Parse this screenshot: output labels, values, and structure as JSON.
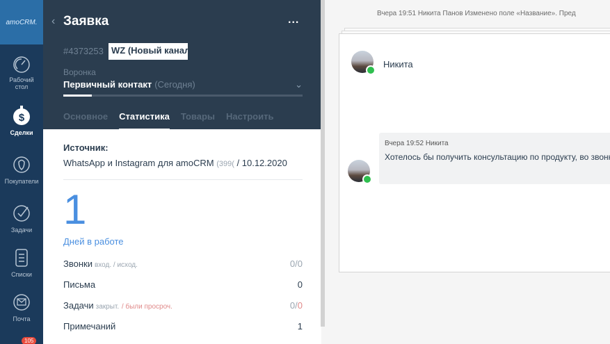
{
  "nav": {
    "logo": "amoCRM.",
    "items": [
      {
        "label": "Рабочий стол",
        "icon": "dashboard-icon"
      },
      {
        "label": "Сделки",
        "icon": "deals-icon"
      },
      {
        "label": "Покупатели",
        "icon": "customers-icon"
      },
      {
        "label": "Задачи",
        "icon": "tasks-icon"
      },
      {
        "label": "Списки",
        "icon": "lists-icon"
      },
      {
        "label": "Почта",
        "icon": "mail-icon"
      }
    ],
    "badge": "105"
  },
  "card": {
    "title": "Заявка",
    "more": "...",
    "lead_id": "#4373253",
    "lead_name": "WZ (Новый канал",
    "funnel_label": "Воронка",
    "stage_name": "Первичный контакт",
    "stage_time": "(Сегодня)",
    "stage_progress": 0.12,
    "tabs": [
      "Основное",
      "Статистика",
      "Товары",
      "Настроить"
    ],
    "active_tab": "Статистика"
  },
  "stats": {
    "source_label": "Источник:",
    "source_value": "WhatsApp и Instagram для amoCRM",
    "source_extra": "(399(",
    "source_date": "/ 10.12.2020",
    "days_count": "1",
    "days_label": "Дней в работе",
    "rows": [
      {
        "label": "Звонки",
        "sub": "вход. / исход.",
        "value": "0/0"
      },
      {
        "label": "Письма",
        "sub": "",
        "value": "0"
      },
      {
        "label": "Задачи",
        "sub": "закрыт.",
        "sub_red": "/ были просроч.",
        "value": "0/",
        "value_red": "0"
      },
      {
        "label": "Примечаний",
        "sub": "",
        "value": "1"
      }
    ]
  },
  "feed": {
    "top_line": "Вчера 19:51 Никита Панов  Изменено поле «Название». Пред",
    "contact_name": "Никита",
    "message_meta": "Вчера 19:52 Никита",
    "message_text": "Хотелось бы получить консультацию по продукту, во звонке?"
  },
  "colors": {
    "nav_bg": "#1b3a5b",
    "header_bg": "#2b3d4f",
    "accent": "#4a8fe0",
    "whatsapp": "#2fbf4f"
  }
}
